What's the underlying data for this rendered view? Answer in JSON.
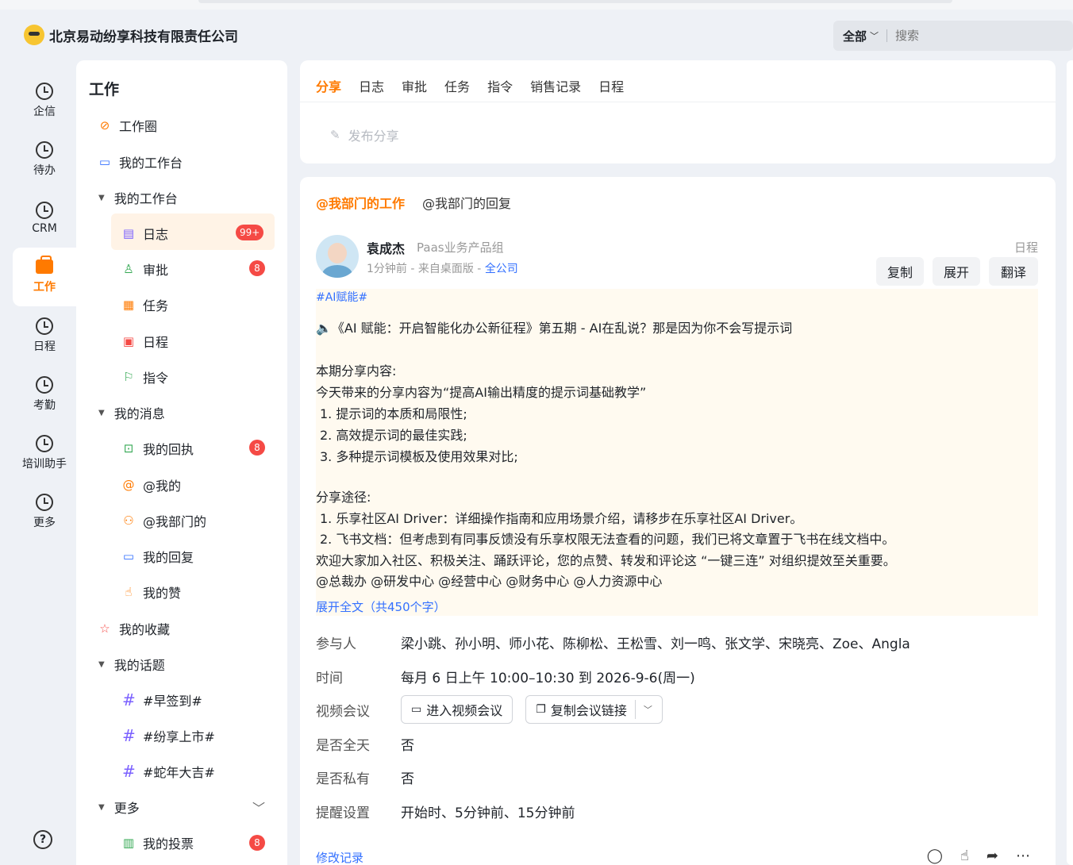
{
  "header": {
    "company": "北京易动纷享科技有限责任公司",
    "search_scope": "全部",
    "search_placeholder": "搜索"
  },
  "nav": [
    {
      "label": "企信",
      "icon": "clock-icon"
    },
    {
      "label": "待办",
      "icon": "clock-icon"
    },
    {
      "label": "CRM",
      "icon": "clock-icon"
    },
    {
      "label": "工作",
      "icon": "briefcase-icon",
      "active": true
    },
    {
      "label": "日程",
      "icon": "clock-icon"
    },
    {
      "label": "考勤",
      "icon": "clock-icon"
    },
    {
      "label": "培训助手",
      "icon": "clock-icon"
    },
    {
      "label": "更多",
      "icon": "clock-icon"
    }
  ],
  "help_glyph": "?",
  "menu": {
    "title": "工作",
    "items": [
      {
        "label": "工作圈",
        "icon": "work-circle-icon"
      },
      {
        "label": "我的工作台",
        "icon": "monitor-icon"
      },
      {
        "label": "我的工作台",
        "icon": "caret-down-icon"
      },
      {
        "label": "日志",
        "icon": "log-icon",
        "badge": "99+"
      },
      {
        "label": "审批",
        "icon": "approval-icon",
        "badge": "8"
      },
      {
        "label": "任务",
        "icon": "task-icon"
      },
      {
        "label": "日程",
        "icon": "calendar-icon"
      },
      {
        "label": "指令",
        "icon": "flag-icon"
      },
      {
        "label": "我的消息",
        "icon": "caret-down-icon"
      },
      {
        "label": "我的回执",
        "icon": "receipt-icon",
        "badge": "8"
      },
      {
        "label": "@我的",
        "icon": "at-icon"
      },
      {
        "label": "@我部门的",
        "icon": "org-icon"
      },
      {
        "label": "我的回复",
        "icon": "reply-icon"
      },
      {
        "label": "我的赞",
        "icon": "thumb-icon"
      },
      {
        "label": "我的收藏",
        "icon": "star-icon"
      },
      {
        "label": "我的话题",
        "icon": "caret-down-icon"
      },
      {
        "label": "#早签到#",
        "icon": "hash-icon"
      },
      {
        "label": "#纷享上市#",
        "icon": "hash-icon"
      },
      {
        "label": "#蛇年大吉#",
        "icon": "hash-icon"
      },
      {
        "label": "更多",
        "icon": "caret-down-icon"
      },
      {
        "label": "我的投票",
        "icon": "vote-icon",
        "badge": "8"
      }
    ]
  },
  "tabs": [
    "分享",
    "日志",
    "审批",
    "任务",
    "指令",
    "销售记录",
    "日程"
  ],
  "compose_placeholder": "发布分享",
  "subtabs": [
    "@我部门的工作",
    "@我部门的回复"
  ],
  "post": {
    "author": "袁成杰",
    "dept": "Paas业务产品组",
    "meta_prefix": "1分钟前 - 来自桌面版 - ",
    "meta_link": "全公司",
    "type_tag": "日程",
    "actions": [
      "复制",
      "展开",
      "翻译"
    ],
    "hashtag": "#AI赋能#",
    "lines": [
      "🔈《AI 赋能：开启智能化办公新征程》第五期 - AI在乱说？那是因为你不会写提示词",
      "",
      "本期分享内容:",
      "今天带来的分享内容为“提高AI输出精度的提示词基础教学”",
      " 1. 提示词的本质和局限性;",
      " 2. 高效提示词的最佳实践;",
      " 3. 多种提示词模板及使用效果对比;",
      "",
      "分享途径:",
      " 1. 乐享社区AI Driver：详细操作指南和应用场景介绍，请移步在乐享社区AI Driver。",
      " 2. 飞书文档：但考虑到有同事反馈没有乐享权限无法查看的问题，我们已将文章置于飞书在线文档中。",
      "欢迎大家加入社区、积极关注、踊跃评论，您的点赞、转发和评论这 “一键三连” 对组织提效至关重要。",
      "@总裁办 @研发中心 @经营中心 @财务中心 @人力资源中心"
    ],
    "expand_label": "展开全文（共450个字）",
    "fields": {
      "participants_label": "参与人",
      "participants": "梁小跳、孙小明、师小花、陈柳松、王松雪、刘一鸣、张文学、宋晓亮、Zoe、Angla",
      "time_label": "时间",
      "time": "每月 6 日上午 10:00–10:30 到 2026-9-6(周一)",
      "video_label": "视频会议",
      "video_join": "进入视频会议",
      "video_copy": "复制会议链接",
      "allday_label": "是否全天",
      "allday": "否",
      "private_label": "是否私有",
      "private": "否",
      "remind_label": "提醒设置",
      "remind": "开始时、5分钟前、15分钟前"
    },
    "modify_label": "修改记录"
  },
  "colors": {
    "accent": "#ff7a00",
    "link": "#3370ff",
    "badge": "#f54a45",
    "content_bg": "#fffaf0"
  }
}
